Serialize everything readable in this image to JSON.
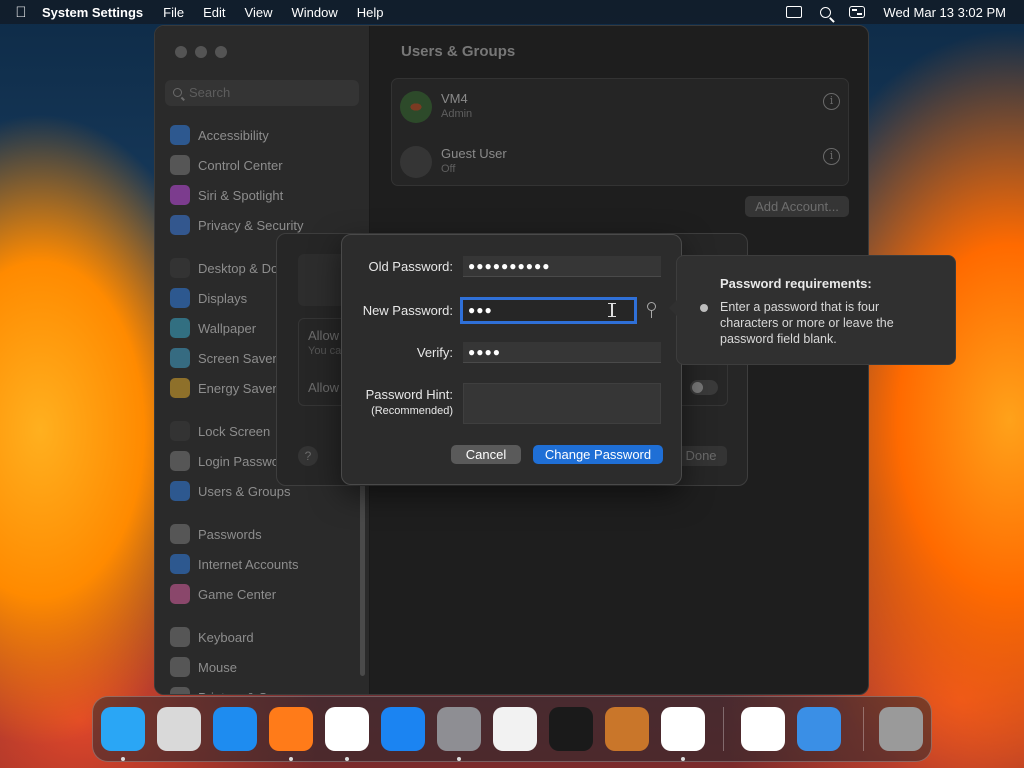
{
  "menubar": {
    "app_name": "System Settings",
    "menus": [
      "File",
      "Edit",
      "View",
      "Window",
      "Help"
    ],
    "clock": "Wed Mar 13  3:02 PM"
  },
  "sidebar": {
    "search_placeholder": "Search",
    "items": [
      {
        "label": "Accessibility",
        "icon": "accessibility-icon",
        "color": "#2f7de1"
      },
      {
        "label": "Control Center",
        "icon": "control-center-icon",
        "color": "#7a7a7a"
      },
      {
        "label": "Siri & Spotlight",
        "icon": "siri-icon",
        "color": "#c04be0"
      },
      {
        "label": "Privacy & Security",
        "icon": "hand-icon",
        "color": "#3a7be0"
      },
      {
        "label": "Desktop & Dock",
        "icon": "desktop-icon",
        "color": "#3a3a3a"
      },
      {
        "label": "Displays",
        "icon": "displays-icon",
        "color": "#2f7de1"
      },
      {
        "label": "Wallpaper",
        "icon": "wallpaper-icon",
        "color": "#38a7c9"
      },
      {
        "label": "Screen Saver",
        "icon": "screen-saver-icon",
        "color": "#40a0c8"
      },
      {
        "label": "Energy Saver",
        "icon": "energy-icon",
        "color": "#e0a92a"
      },
      {
        "label": "Lock Screen",
        "icon": "lock-icon",
        "color": "#3a3a3a"
      },
      {
        "label": "Login Password",
        "icon": "login-password-icon",
        "color": "#7a7a7a"
      },
      {
        "label": "Users & Groups",
        "icon": "users-icon",
        "color": "#2f7de1"
      },
      {
        "label": "Passwords",
        "icon": "key-icon",
        "color": "#7a7a7a"
      },
      {
        "label": "Internet Accounts",
        "icon": "at-icon",
        "color": "#2f7de1"
      },
      {
        "label": "Game Center",
        "icon": "game-center-icon",
        "color": "#d85fa0"
      },
      {
        "label": "Keyboard",
        "icon": "keyboard-icon",
        "color": "#7a7a7a"
      },
      {
        "label": "Mouse",
        "icon": "mouse-icon",
        "color": "#7a7a7a"
      },
      {
        "label": "Printers & Scanners",
        "icon": "printer-icon",
        "color": "#7a7a7a"
      }
    ]
  },
  "main": {
    "title": "Users & Groups",
    "users": [
      {
        "name": "VM4",
        "role": "Admin"
      },
      {
        "name": "Guest User",
        "role": "Off"
      }
    ],
    "add_account_label": "Add Account..."
  },
  "back_sheet": {
    "allow1": "Allow",
    "allow1_sub": "You ca",
    "allow2": "Allow",
    "help": "?",
    "done": "Done"
  },
  "password_dialog": {
    "old_label": "Old Password:",
    "old_value": "●●●●●●●●●●",
    "new_label": "New Password:",
    "new_value": "●●●",
    "verify_label": "Verify:",
    "verify_value": "●●●●",
    "hint_label": "Password Hint:",
    "hint_sub": "(Recommended)",
    "hint_value": "",
    "cancel_label": "Cancel",
    "change_label": "Change Password"
  },
  "popover": {
    "title": "Password requirements:",
    "requirement": "Enter a password that is four characters or more or leave the password field blank."
  },
  "dock": {
    "apps": [
      {
        "name": "finder-icon",
        "color": "#2aa6f5",
        "running": true
      },
      {
        "name": "launchpad-icon",
        "color": "#d9d9d9",
        "running": false
      },
      {
        "name": "safari-icon",
        "color": "#1e8cf0",
        "running": false
      },
      {
        "name": "firefox-icon",
        "color": "#ff7b19",
        "running": true
      },
      {
        "name": "chrome-icon",
        "color": "#ffffff",
        "running": true
      },
      {
        "name": "app-store-icon",
        "color": "#1b84f2",
        "running": false
      },
      {
        "name": "system-settings-icon",
        "color": "#8e8e93",
        "running": true
      },
      {
        "name": "textedit-icon",
        "color": "#f2f2f2",
        "running": false
      },
      {
        "name": "terminal-icon",
        "color": "#1a1a1a",
        "running": false
      },
      {
        "name": "garageband-icon",
        "color": "#c9762a",
        "running": false
      },
      {
        "name": "vscode-icon",
        "color": "#ffffff",
        "running": true
      },
      {
        "name": "visual-studio-icon",
        "color": "#ffffff",
        "running": false
      },
      {
        "name": "weather-icon",
        "color": "#3a8fe6",
        "running": false
      },
      {
        "name": "trash-icon",
        "color": "#9a9a9a",
        "running": false
      }
    ]
  }
}
